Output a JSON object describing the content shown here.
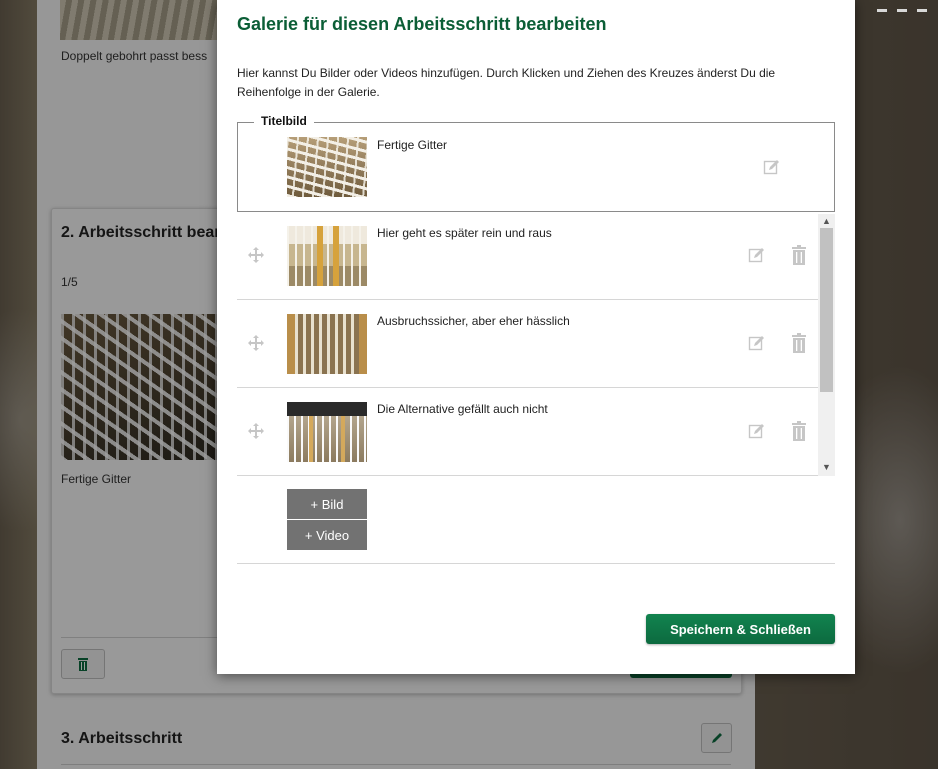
{
  "background": {
    "top_caption": "Doppelt gebohrt passt bess",
    "card_title": "2. Arbeitsschritt bear",
    "card_counter": "1/5",
    "card_caption": "Fertige Gitter",
    "step3_title": "3. Arbeitsschritt"
  },
  "modal": {
    "title": "Galerie für diesen Arbeitsschritt bearbeiten",
    "description": "Hier kannst Du Bilder oder Videos hinzufügen. Durch Klicken und Ziehen des Kreuzes änderst Du die Reihenfolge in der Galerie.",
    "cover": {
      "legend": "Titelbild",
      "caption": "Fertige Gitter",
      "thumb_icon": "image-thumbnail"
    },
    "items": [
      {
        "caption": "Hier geht es später rein und raus"
      },
      {
        "caption": "Ausbruchssicher, aber eher hässlich"
      },
      {
        "caption": "Die Alternative gefällt auch nicht"
      }
    ],
    "add_image_label": "+ Bild",
    "add_video_label": "+ Video",
    "save_label": "Speichern & Schließen"
  },
  "icons": {
    "move": "move-icon",
    "edit": "edit-icon",
    "delete": "trash-icon",
    "scroll_up": "▲",
    "scroll_down": "▼"
  },
  "colors": {
    "accent": "#0b5e36",
    "button_gray": "#727272",
    "icon_gray": "#c6c6c6"
  }
}
